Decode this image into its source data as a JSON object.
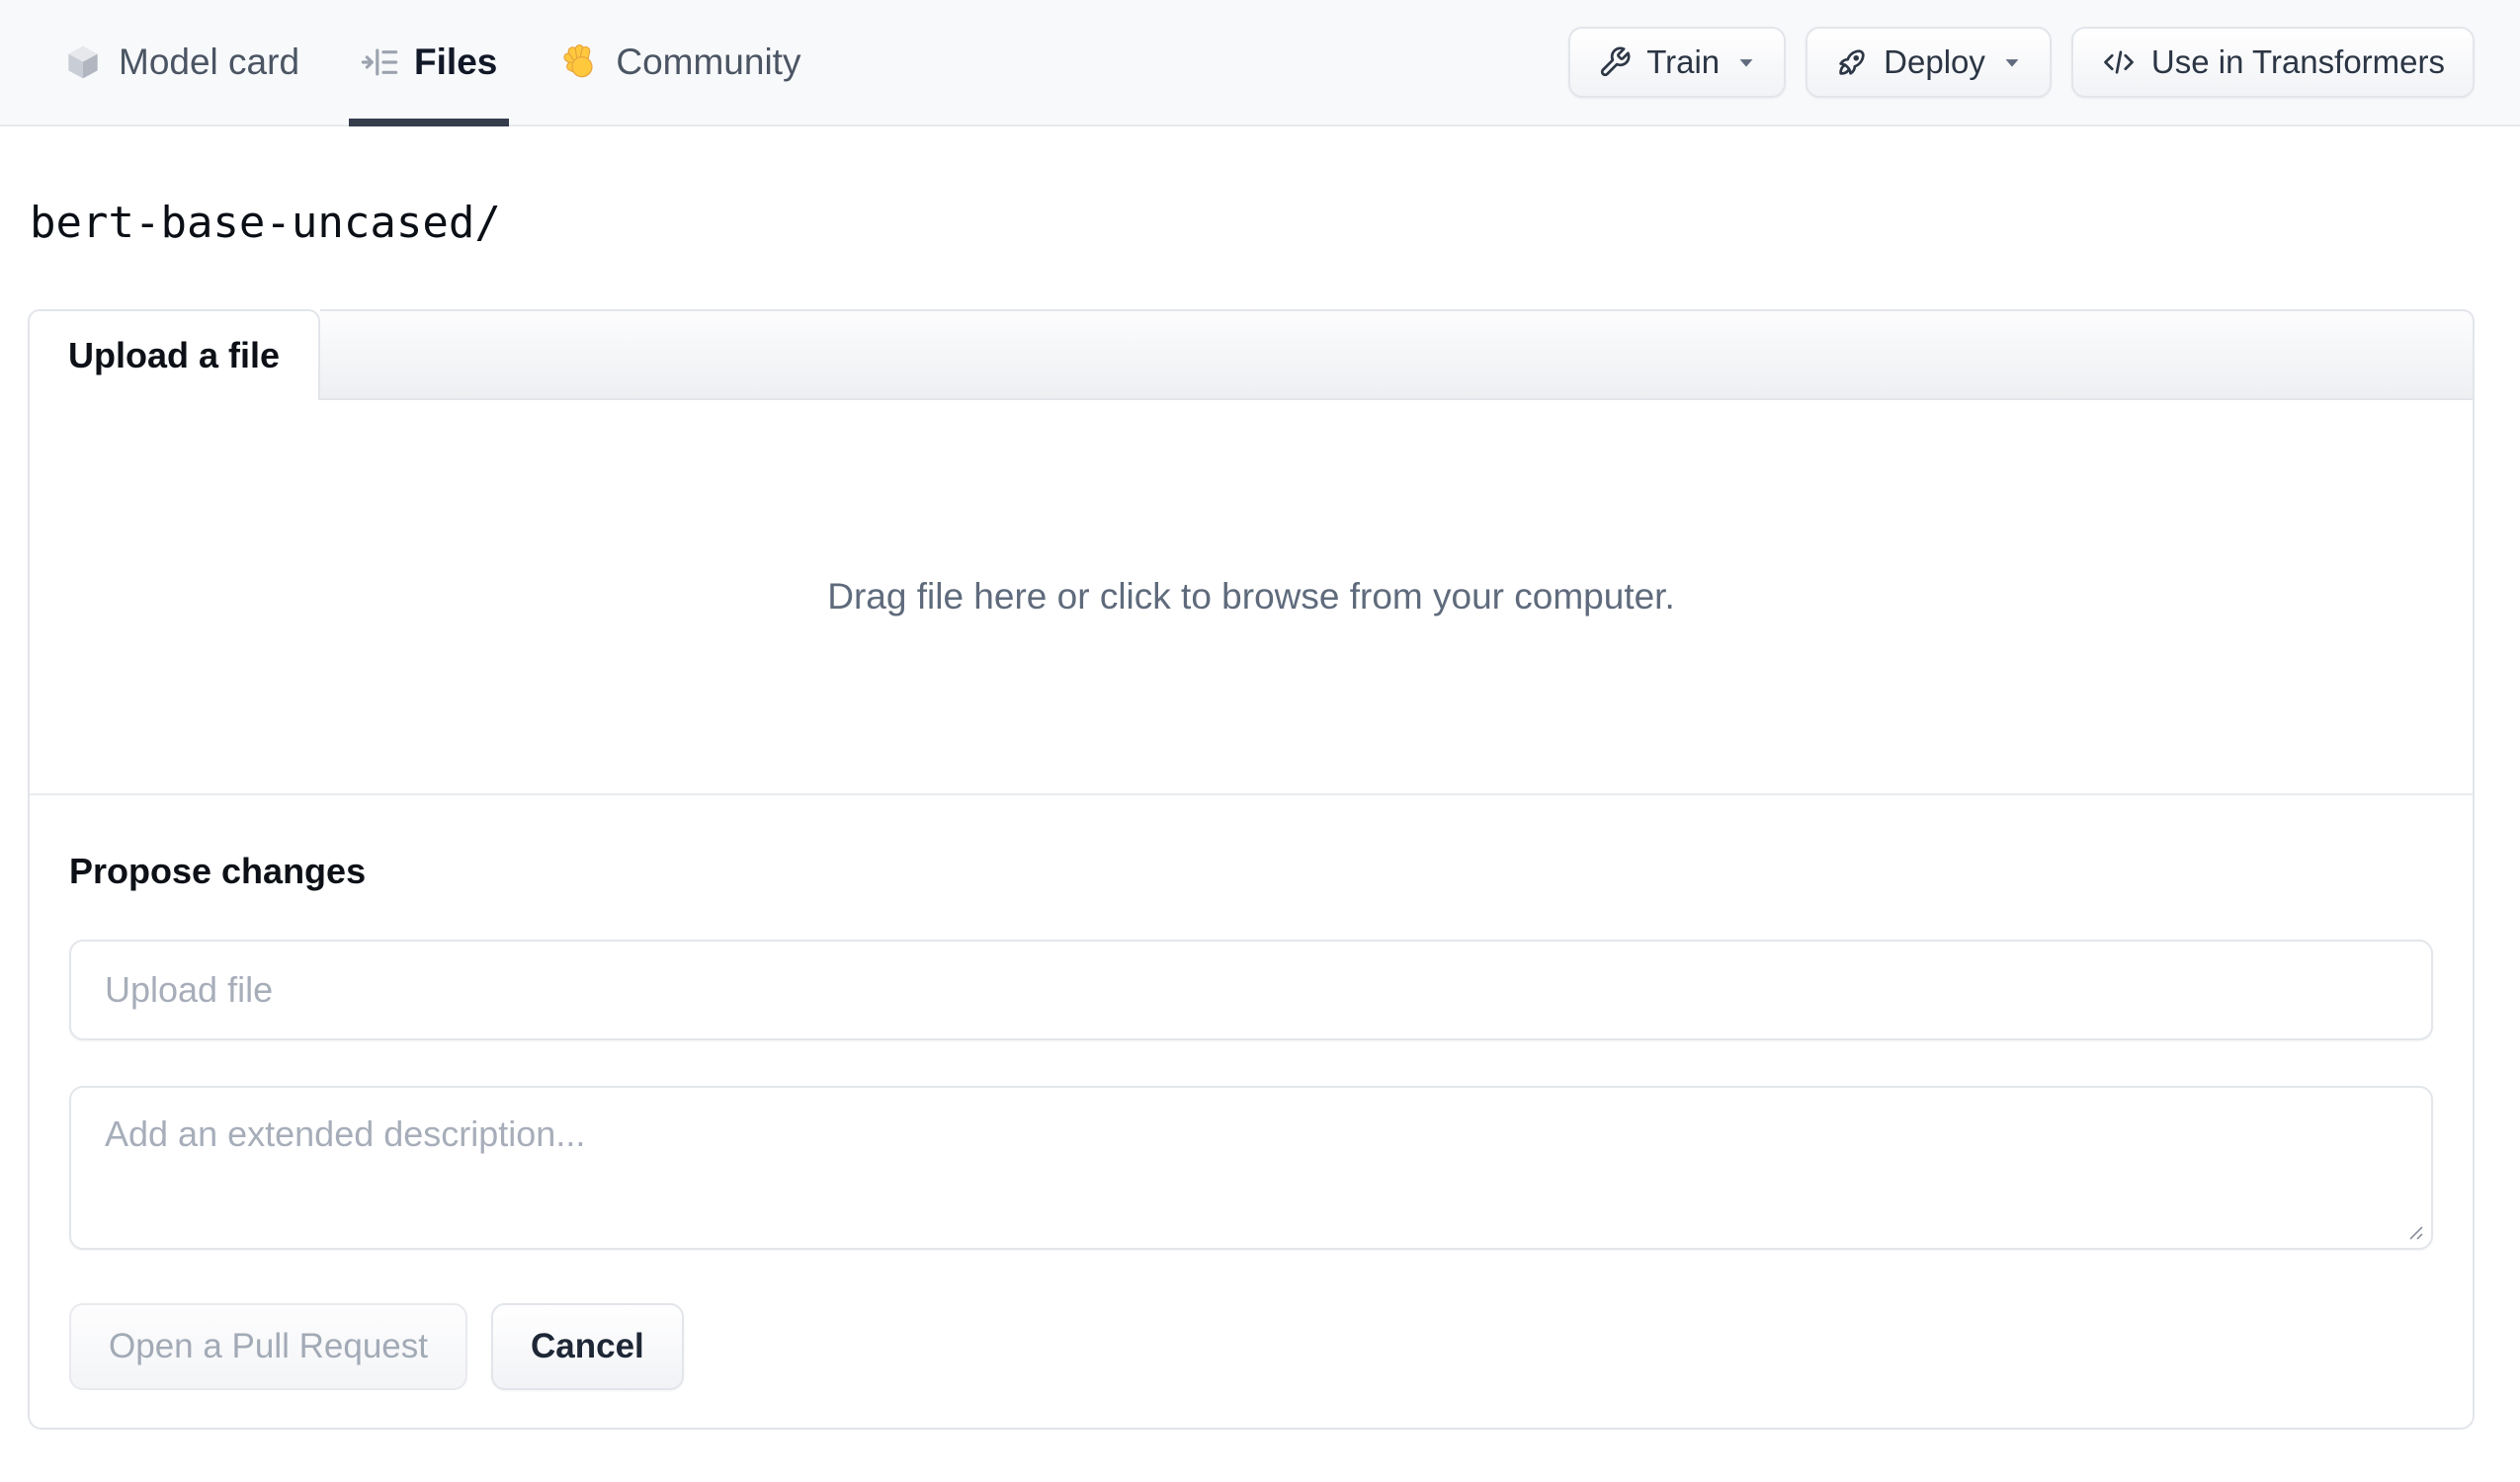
{
  "header": {
    "tabs": [
      {
        "label": "Model card",
        "icon": "cube-icon",
        "active": false
      },
      {
        "label": "Files",
        "icon": "files-versions-icon",
        "active": true
      },
      {
        "label": "Community",
        "icon": "waving-hand-icon",
        "active": false
      }
    ],
    "actions": [
      {
        "label": "Train",
        "icon": "wrench-icon",
        "dropdown": true
      },
      {
        "label": "Deploy",
        "icon": "rocket-icon",
        "dropdown": true
      },
      {
        "label": "Use in Transformers",
        "icon": "code-icon",
        "dropdown": false
      }
    ]
  },
  "path_heading": {
    "text": "bert-base-uncased/"
  },
  "upload_panel": {
    "tab_label": "Upload a file",
    "dropzone_text": "Drag file here or click to browse from your computer.",
    "propose": {
      "heading": "Propose changes",
      "filename_placeholder": "Upload file",
      "description_placeholder": "Add an extended description...",
      "submit_label": "Open a Pull Request",
      "cancel_label": "Cancel"
    }
  },
  "colors": {
    "topbar_bg": "#f8f9fb",
    "active_tab_underline": "#353d4d",
    "inactive_tab_text": "#4b5563",
    "panel_border": "#e2e5ea",
    "dropzone_text": "#5f6b7c",
    "placeholder_text": "#a7aeba",
    "disabled_button_text": "#a2aab6",
    "hand_emoji_yellow": "#ffc83d"
  }
}
